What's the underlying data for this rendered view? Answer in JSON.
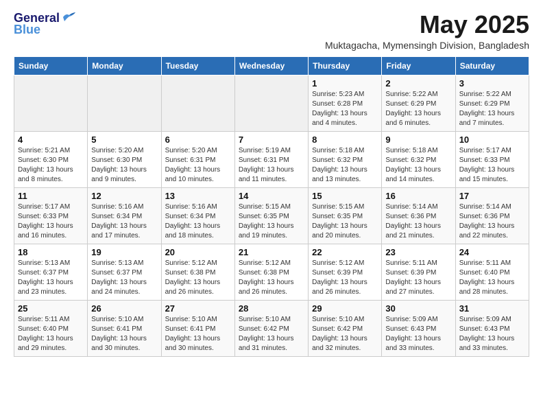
{
  "logo": {
    "line1": "General",
    "line2": "Blue"
  },
  "title": "May 2025",
  "subtitle": "Muktagacha, Mymensingh Division, Bangladesh",
  "weekdays": [
    "Sunday",
    "Monday",
    "Tuesday",
    "Wednesday",
    "Thursday",
    "Friday",
    "Saturday"
  ],
  "weeks": [
    [
      {
        "day": "",
        "info": ""
      },
      {
        "day": "",
        "info": ""
      },
      {
        "day": "",
        "info": ""
      },
      {
        "day": "",
        "info": ""
      },
      {
        "day": "1",
        "info": "Sunrise: 5:23 AM\nSunset: 6:28 PM\nDaylight: 13 hours\nand 4 minutes."
      },
      {
        "day": "2",
        "info": "Sunrise: 5:22 AM\nSunset: 6:29 PM\nDaylight: 13 hours\nand 6 minutes."
      },
      {
        "day": "3",
        "info": "Sunrise: 5:22 AM\nSunset: 6:29 PM\nDaylight: 13 hours\nand 7 minutes."
      }
    ],
    [
      {
        "day": "4",
        "info": "Sunrise: 5:21 AM\nSunset: 6:30 PM\nDaylight: 13 hours\nand 8 minutes."
      },
      {
        "day": "5",
        "info": "Sunrise: 5:20 AM\nSunset: 6:30 PM\nDaylight: 13 hours\nand 9 minutes."
      },
      {
        "day": "6",
        "info": "Sunrise: 5:20 AM\nSunset: 6:31 PM\nDaylight: 13 hours\nand 10 minutes."
      },
      {
        "day": "7",
        "info": "Sunrise: 5:19 AM\nSunset: 6:31 PM\nDaylight: 13 hours\nand 11 minutes."
      },
      {
        "day": "8",
        "info": "Sunrise: 5:18 AM\nSunset: 6:32 PM\nDaylight: 13 hours\nand 13 minutes."
      },
      {
        "day": "9",
        "info": "Sunrise: 5:18 AM\nSunset: 6:32 PM\nDaylight: 13 hours\nand 14 minutes."
      },
      {
        "day": "10",
        "info": "Sunrise: 5:17 AM\nSunset: 6:33 PM\nDaylight: 13 hours\nand 15 minutes."
      }
    ],
    [
      {
        "day": "11",
        "info": "Sunrise: 5:17 AM\nSunset: 6:33 PM\nDaylight: 13 hours\nand 16 minutes."
      },
      {
        "day": "12",
        "info": "Sunrise: 5:16 AM\nSunset: 6:34 PM\nDaylight: 13 hours\nand 17 minutes."
      },
      {
        "day": "13",
        "info": "Sunrise: 5:16 AM\nSunset: 6:34 PM\nDaylight: 13 hours\nand 18 minutes."
      },
      {
        "day": "14",
        "info": "Sunrise: 5:15 AM\nSunset: 6:35 PM\nDaylight: 13 hours\nand 19 minutes."
      },
      {
        "day": "15",
        "info": "Sunrise: 5:15 AM\nSunset: 6:35 PM\nDaylight: 13 hours\nand 20 minutes."
      },
      {
        "day": "16",
        "info": "Sunrise: 5:14 AM\nSunset: 6:36 PM\nDaylight: 13 hours\nand 21 minutes."
      },
      {
        "day": "17",
        "info": "Sunrise: 5:14 AM\nSunset: 6:36 PM\nDaylight: 13 hours\nand 22 minutes."
      }
    ],
    [
      {
        "day": "18",
        "info": "Sunrise: 5:13 AM\nSunset: 6:37 PM\nDaylight: 13 hours\nand 23 minutes."
      },
      {
        "day": "19",
        "info": "Sunrise: 5:13 AM\nSunset: 6:37 PM\nDaylight: 13 hours\nand 24 minutes."
      },
      {
        "day": "20",
        "info": "Sunrise: 5:12 AM\nSunset: 6:38 PM\nDaylight: 13 hours\nand 26 minutes."
      },
      {
        "day": "21",
        "info": "Sunrise: 5:12 AM\nSunset: 6:38 PM\nDaylight: 13 hours\nand 26 minutes."
      },
      {
        "day": "22",
        "info": "Sunrise: 5:12 AM\nSunset: 6:39 PM\nDaylight: 13 hours\nand 26 minutes."
      },
      {
        "day": "23",
        "info": "Sunrise: 5:11 AM\nSunset: 6:39 PM\nDaylight: 13 hours\nand 27 minutes."
      },
      {
        "day": "24",
        "info": "Sunrise: 5:11 AM\nSunset: 6:40 PM\nDaylight: 13 hours\nand 28 minutes."
      }
    ],
    [
      {
        "day": "25",
        "info": "Sunrise: 5:11 AM\nSunset: 6:40 PM\nDaylight: 13 hours\nand 29 minutes."
      },
      {
        "day": "26",
        "info": "Sunrise: 5:10 AM\nSunset: 6:41 PM\nDaylight: 13 hours\nand 30 minutes."
      },
      {
        "day": "27",
        "info": "Sunrise: 5:10 AM\nSunset: 6:41 PM\nDaylight: 13 hours\nand 30 minutes."
      },
      {
        "day": "28",
        "info": "Sunrise: 5:10 AM\nSunset: 6:42 PM\nDaylight: 13 hours\nand 31 minutes."
      },
      {
        "day": "29",
        "info": "Sunrise: 5:10 AM\nSunset: 6:42 PM\nDaylight: 13 hours\nand 32 minutes."
      },
      {
        "day": "30",
        "info": "Sunrise: 5:09 AM\nSunset: 6:43 PM\nDaylight: 13 hours\nand 33 minutes."
      },
      {
        "day": "31",
        "info": "Sunrise: 5:09 AM\nSunset: 6:43 PM\nDaylight: 13 hours\nand 33 minutes."
      }
    ]
  ]
}
